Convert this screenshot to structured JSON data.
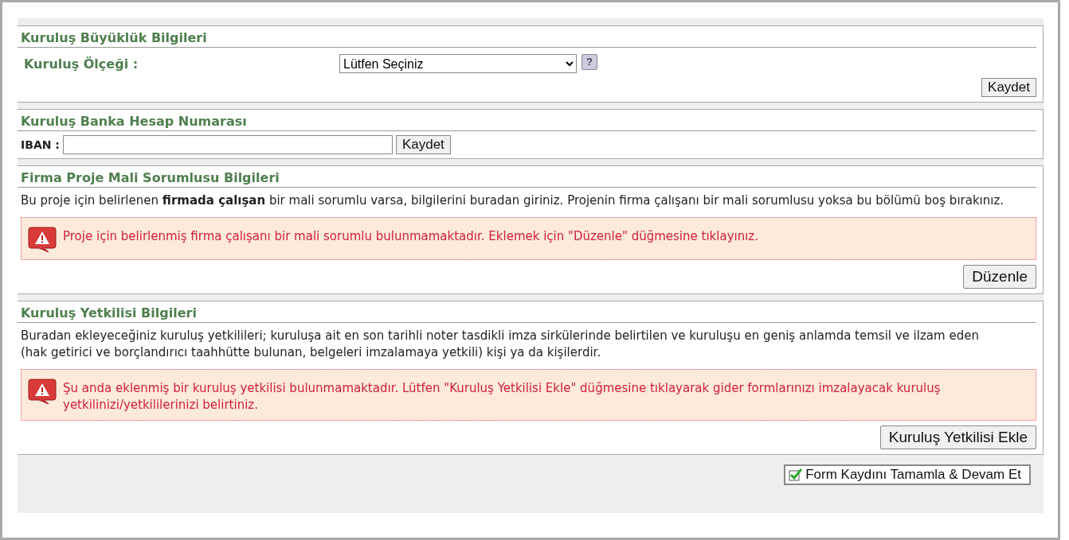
{
  "sections": [
    {
      "kind": "scale",
      "title": "Kuruluş Büyüklük Bilgileri",
      "label": "Kuruluş Ölçeği :",
      "select": {
        "value": "Lütfen Seçiniz"
      },
      "help": "?",
      "button": "Kaydet"
    },
    {
      "kind": "iban",
      "title": "Kuruluş Banka Hesap Numarası",
      "label": "IBAN :",
      "button": "Kaydet"
    },
    {
      "kind": "notice",
      "title": "Firma Proje Mali Sorumlusu Bilgileri",
      "description": "Bu proje için belirlenen **firmada çalışan** bir mali sorumlu varsa, bilgilerini buradan giriniz. Projenin firma çalışanı bir mali sorumlusu yoksa bu bölümü boş bırakınız.",
      "alert": "Proje için belirlenmiş firma çalışanı bir mali sorumlu bulunmamaktadır. Eklemek için \"Düzenle\" düğmesine tıklayınız.",
      "button": "Düzenle"
    },
    {
      "kind": "notice",
      "title": "Kuruluş Yetkilisi Bilgileri",
      "description": "Buradan ekleyeceğiniz kuruluş yetkilileri; kuruluşa ait en son tarihli noter tasdikli imza sirkülerinde belirtilen ve kuruluşu en geniş anlamda temsil ve ilzam eden (hak getirici ve borçlandırıcı taahhütte bulunan, belgeleri imzalamaya yetkili) kişi ya da kişilerdir.",
      "alert": "Şu anda eklenmiş bir kuruluş yetkilisi bulunmamaktadır. Lütfen \"Kuruluş Yetkilisi Ekle\" düğmesine tıklayarak gider formlarınızı imzalayacak kuruluş yetkilinizi/yetkililerinizi belirtiniz.",
      "button": "Kuruluş Yetkilisi Ekle"
    }
  ],
  "footer_button": "Form Kaydını Tamamla & Devam Et"
}
